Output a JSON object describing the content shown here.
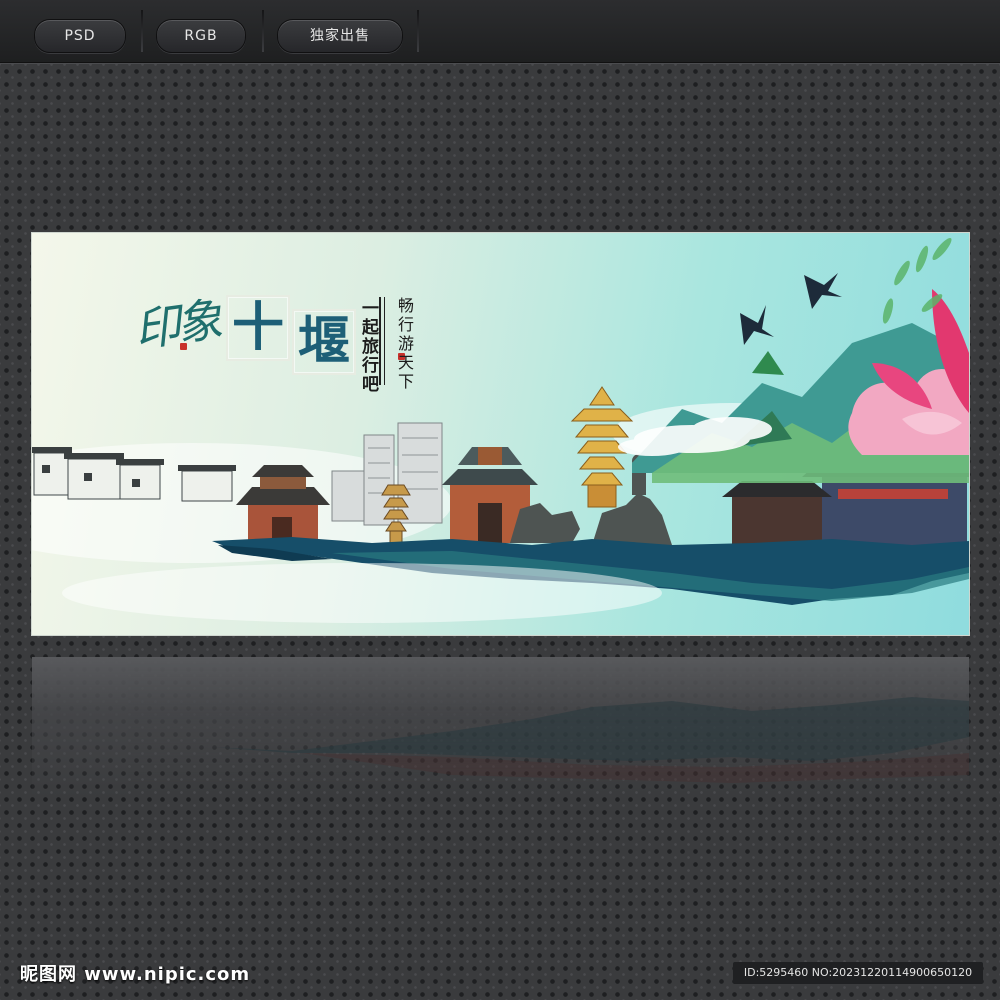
{
  "tabs": [
    {
      "label": "PSD"
    },
    {
      "label": "RGB"
    },
    {
      "label": "独家出售"
    }
  ],
  "poster": {
    "title_script": "印象",
    "title_char_1": "十",
    "title_char_2": "堰",
    "vertical_slogan_1": "一起旅行吧",
    "vertical_slogan_2": "畅行游天下",
    "colors": {
      "sky_left": "#f4f7ea",
      "sky_right": "#8fdcde",
      "ink_water": "#164e69",
      "title_ink": "#1d5f77",
      "lotus": "#e8467f",
      "pagoda_gold": "#d9a83b"
    }
  },
  "footer": {
    "site_logo": "昵图网 www.nipic.com",
    "image_id": "ID:5295460 NO:20231220114900650120"
  }
}
